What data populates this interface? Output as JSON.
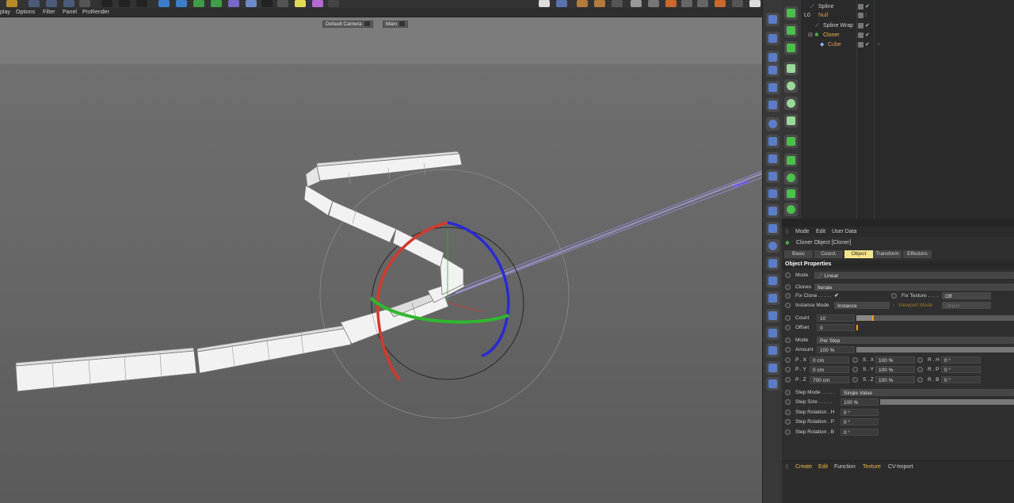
{
  "menu": {
    "items": [
      "play",
      "Options",
      "Filter",
      "Panel",
      "ProRender"
    ]
  },
  "viewport": {
    "camera_label": "Default Camera",
    "camera_suffix": "••",
    "view_label": "Main"
  },
  "top_right_label": "0",
  "object_manager": {
    "rows": [
      {
        "name": "Spline",
        "color": "#cfcfcf"
      },
      {
        "name": "Null",
        "color": "#e09a55"
      },
      {
        "name": "Spline Wrap",
        "color": "#cfcfcf"
      },
      {
        "name": "Cloner",
        "color": "#f0b64a"
      },
      {
        "name": "Cube",
        "color": "#e09a55"
      }
    ]
  },
  "attributes": {
    "header": [
      "Mode",
      "Edit",
      "User Data"
    ],
    "object_title": "Cloner Object [Cloner]",
    "tabs": [
      "Basic",
      "Coord.",
      "Object",
      "Transform",
      "Effectors"
    ],
    "active_tab": "Object",
    "section": "Object Properties",
    "mode_label": "Mode",
    "mode_value": "Linear",
    "clones_label": "Clones",
    "clones_value": "Iterate",
    "fix_clone_label": "Fix Clone . . . . .",
    "fix_clone_value": "✔",
    "fix_texture_label": "Fix Texture . . . .",
    "fix_texture_value": "Off",
    "instance_mode_label": "Instance Mode",
    "instance_mode_value": "Instance",
    "viewport_mode_label": "Viewport Mode",
    "viewport_mode_value": "Object",
    "count_label": "Count",
    "count_value": "10",
    "count_fraction": 0.1,
    "offset_label": "Offset",
    "offset_value": "0",
    "offset_fraction": 0.0,
    "mode2_label": "Mode",
    "mode2_value": "Per Step",
    "amount_label": "Amount",
    "amount_value": "100 %",
    "px_label": "P . X",
    "px_value": "0 cm",
    "py_label": "P . Y",
    "py_value": "0 cm",
    "pz_label": "P . Z",
    "pz_value": "700 cm",
    "sx_label": "S . X",
    "sx_value": "100 %",
    "sy_label": "S . Y",
    "sy_value": "100 %",
    "sz_label": "S . Z",
    "sz_value": "100 %",
    "rh_label": "R . H",
    "rh_value": "0 °",
    "rp_label": "R . P",
    "rp_value": "0 °",
    "rb_label": "R . B",
    "rb_value": "0 °",
    "step_mode_label": "Step Mode . . . . .",
    "step_mode_value": "Single Value",
    "step_size_label": "Step Size . . . . .",
    "step_size_value": "100 %",
    "step_rot_h_label": "Step Rotation . H",
    "step_rot_h_value": "0 °",
    "step_rot_p_label": "Step Rotation . P",
    "step_rot_p_value": "0 °",
    "step_rot_b_label": "Step Rotation . B",
    "step_rot_b_value": "0 °"
  },
  "material_manager": {
    "menu": [
      "Create",
      "Edit",
      "Function",
      "Texture",
      "CV-Import"
    ]
  },
  "colors": {
    "accent_tab": "#f6e48b",
    "x_axis": "#d23a2e",
    "y_axis": "#2eb82e",
    "z_axis": "#2a2ad6",
    "null_orange": "#e09a55",
    "cloner_orange": "#f0b64a"
  }
}
